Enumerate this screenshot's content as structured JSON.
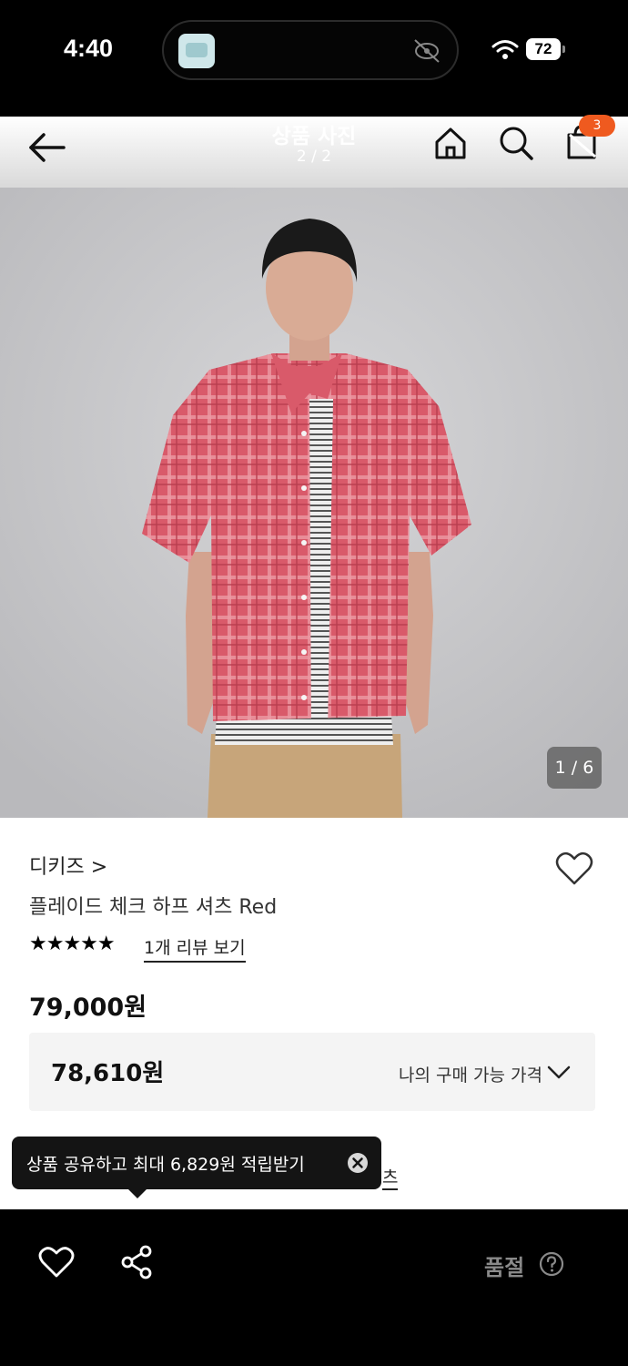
{
  "status": {
    "time": "4:40",
    "battery": "72"
  },
  "header": {
    "title": "상품 사진",
    "counter": "2 / 2",
    "cart_count": "3"
  },
  "image": {
    "counter": "1 / 6"
  },
  "product": {
    "brand": "디키즈 >",
    "name": "플레이드 체크 하프 셔츠 Red",
    "stars": "★★★★★",
    "rating": 5,
    "review_link": "1개 리뷰 보기",
    "price": "79,000원",
    "my_price": "78,610원",
    "my_price_label": "나의 구매 가능 가격",
    "partial_link": "츠"
  },
  "tooltip": {
    "text": "상품 공유하고 최대 6,829원 적립받기"
  },
  "bottom": {
    "sold_out": "품절"
  },
  "colors": {
    "accent": "#ef5a1f",
    "shirt": "#d95a6a",
    "pants": "#c7a57a",
    "background": "#c8c8ca"
  }
}
